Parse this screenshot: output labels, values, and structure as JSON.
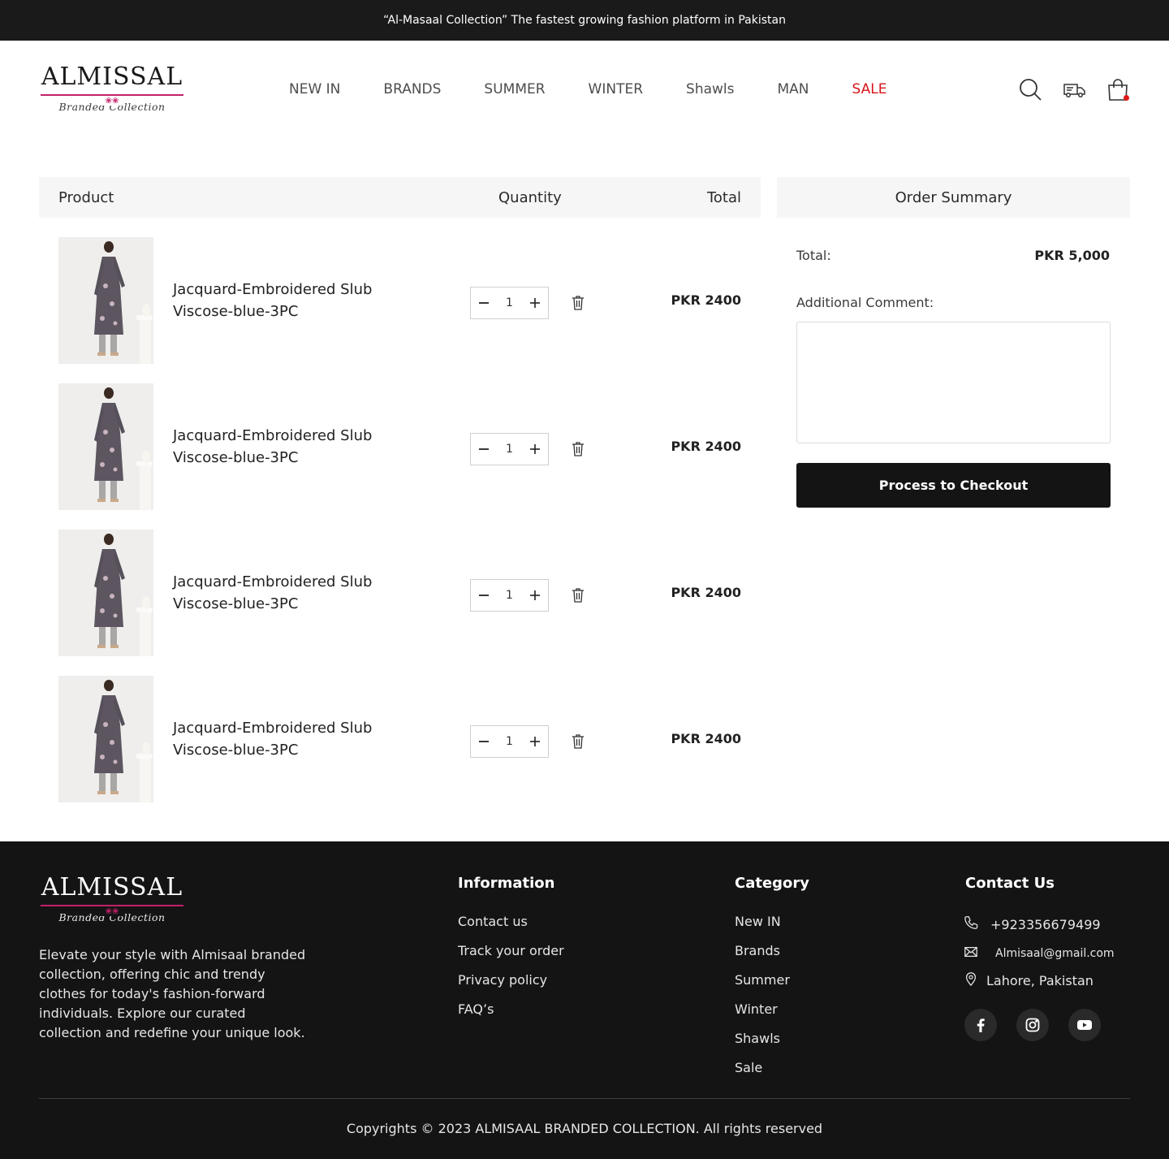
{
  "announcement": "“Al-Masaal Collection” The fastest growing fashion platform in Pakistan",
  "logo": {
    "brand": "ALMISSAL",
    "subtitle": "Branded Collection"
  },
  "nav": [
    {
      "label": "NEW IN"
    },
    {
      "label": "BRANDS"
    },
    {
      "label": "SUMMER"
    },
    {
      "label": "WINTER"
    },
    {
      "label": "Shawls"
    },
    {
      "label": "MAN"
    },
    {
      "label": "SALE"
    }
  ],
  "header_icons": [
    "search-icon",
    "delivery-truck-icon",
    "shopping-bag-icon"
  ],
  "cart": {
    "headers": {
      "product": "Product",
      "quantity": "Quantity",
      "total": "Total"
    },
    "items": [
      {
        "name": "Jacquard-Embroidered Slub Viscose-blue-3PC",
        "quantity": "1",
        "price": "PKR 2400"
      },
      {
        "name": "Jacquard-Embroidered Slub Viscose-blue-3PC",
        "quantity": "1",
        "price": "PKR 2400"
      },
      {
        "name": "Jacquard-Embroidered Slub Viscose-blue-3PC",
        "quantity": "1",
        "price": "PKR 2400"
      },
      {
        "name": "Jacquard-Embroidered Slub Viscose-blue-3PC",
        "quantity": "1",
        "price": "PKR 2400"
      }
    ]
  },
  "summary": {
    "title": "Order Summary",
    "total_label": "Total:",
    "total_value": "PKR 5,000",
    "comment_label": "Additional Comment:",
    "comment_value": "",
    "checkout_label": "Process to Checkout"
  },
  "footer": {
    "description": "Elevate your style with Almisaal branded collection, offering chic and trendy clothes for today's fashion-forward individuals. Explore our curated collection and redefine your unique look.",
    "information": {
      "title": "Information",
      "links": [
        "Contact us",
        "Track your order",
        "Privacy policy",
        "FAQ’s"
      ]
    },
    "category": {
      "title": "Category",
      "links": [
        "New IN",
        "Brands",
        "Summer",
        "Winter",
        "Shawls",
        "Sale"
      ]
    },
    "contact": {
      "title": "Contact Us",
      "phone": "+923356679499",
      "email": "Almisaal@gmail.com",
      "location": "Lahore, Pakistan"
    },
    "socials": [
      "facebook-icon",
      "instagram-icon",
      "youtube-icon"
    ],
    "copyright": "Copyrights © 2023 ALMISAAL BRANDED COLLECTION. All rights reserved"
  },
  "colors": {
    "accent_red": "#d7151b",
    "logo_pink": "#c4206b",
    "dark": "#141414",
    "table_header_bg": "#f6f6f6"
  }
}
